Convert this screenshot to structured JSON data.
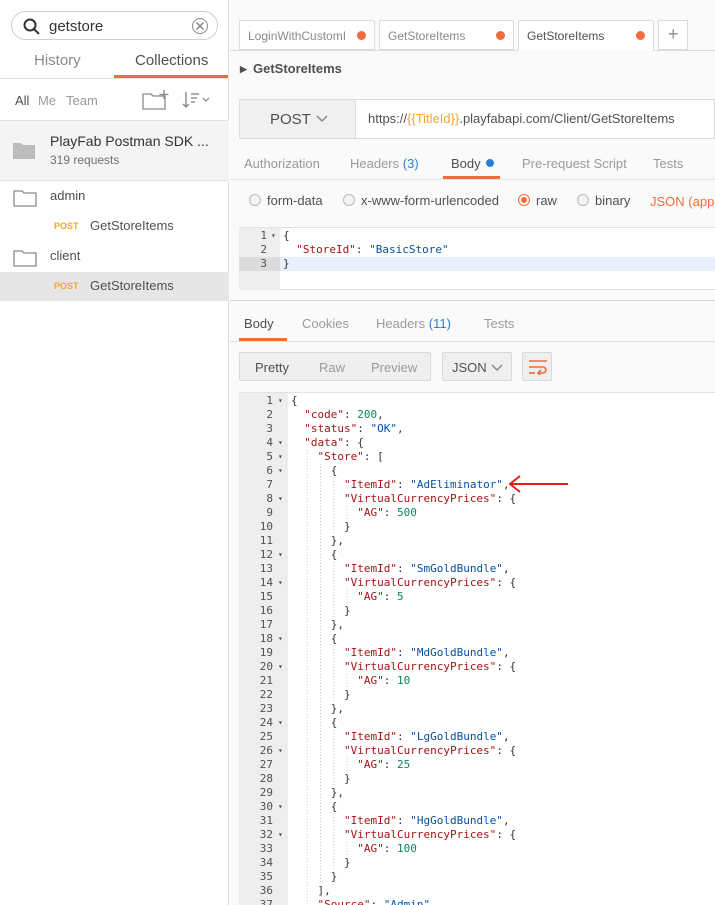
{
  "sidebar": {
    "search": {
      "value": "getstore"
    },
    "tabs": [
      "History",
      "Collections"
    ],
    "filters": [
      "All",
      "Me",
      "Team"
    ],
    "collection": {
      "name": "PlayFab Postman SDK ...",
      "count": "319 requests"
    },
    "folders": [
      {
        "name": "admin",
        "request": {
          "method": "POST",
          "name": "GetStoreItems"
        }
      },
      {
        "name": "client",
        "request": {
          "method": "POST",
          "name": "GetStoreItems"
        }
      }
    ]
  },
  "tabs": [
    {
      "label": "LoginWithCustomI"
    },
    {
      "label": "GetStoreItems"
    },
    {
      "label": "GetStoreItems"
    }
  ],
  "new_tab": "+",
  "request": {
    "title": "GetStoreItems",
    "method": "POST",
    "url_prefix": "https://",
    "url_var": "{{TitleId}}",
    "url_suffix": ".playfabapi.com/Client/GetStoreItems",
    "tabs": {
      "authorization": "Authorization",
      "headers": "Headers",
      "headers_count": "(3)",
      "body": "Body",
      "prerequest": "Pre-request Script",
      "tests": "Tests"
    },
    "body_modes": [
      "form-data",
      "x-www-form-urlencoded",
      "raw",
      "binary"
    ],
    "content_type": "JSON (applic",
    "body_lines": [
      {
        "n": "1",
        "fold": true,
        "text": "{"
      },
      {
        "n": "2",
        "fold": false,
        "text": "  \"StoreId\": \"BasicStore\""
      },
      {
        "n": "3",
        "fold": false,
        "text": "}"
      }
    ]
  },
  "response": {
    "tabs": {
      "body": "Body",
      "cookies": "Cookies",
      "headers": "Headers",
      "headers_count": "(11)",
      "tests": "Tests"
    },
    "view_buttons": [
      "Pretty",
      "Raw",
      "Preview"
    ],
    "format": "JSON",
    "lines": [
      {
        "n": "1",
        "fold": true,
        "text": "{"
      },
      {
        "n": "2",
        "fold": false,
        "text": "  \"code\": 200,"
      },
      {
        "n": "3",
        "fold": false,
        "text": "  \"status\": \"OK\","
      },
      {
        "n": "4",
        "fold": true,
        "text": "  \"data\": {"
      },
      {
        "n": "5",
        "fold": true,
        "text": "    \"Store\": ["
      },
      {
        "n": "6",
        "fold": true,
        "text": "      {"
      },
      {
        "n": "7",
        "fold": false,
        "text": "        \"ItemId\": \"AdEliminator\","
      },
      {
        "n": "8",
        "fold": true,
        "text": "        \"VirtualCurrencyPrices\": {"
      },
      {
        "n": "9",
        "fold": false,
        "text": "          \"AG\": 500"
      },
      {
        "n": "10",
        "fold": false,
        "text": "        }"
      },
      {
        "n": "11",
        "fold": false,
        "text": "      },"
      },
      {
        "n": "12",
        "fold": true,
        "text": "      {"
      },
      {
        "n": "13",
        "fold": false,
        "text": "        \"ItemId\": \"SmGoldBundle\","
      },
      {
        "n": "14",
        "fold": true,
        "text": "        \"VirtualCurrencyPrices\": {"
      },
      {
        "n": "15",
        "fold": false,
        "text": "          \"AG\": 5"
      },
      {
        "n": "16",
        "fold": false,
        "text": "        }"
      },
      {
        "n": "17",
        "fold": false,
        "text": "      },"
      },
      {
        "n": "18",
        "fold": true,
        "text": "      {"
      },
      {
        "n": "19",
        "fold": false,
        "text": "        \"ItemId\": \"MdGoldBundle\","
      },
      {
        "n": "20",
        "fold": true,
        "text": "        \"VirtualCurrencyPrices\": {"
      },
      {
        "n": "21",
        "fold": false,
        "text": "          \"AG\": 10"
      },
      {
        "n": "22",
        "fold": false,
        "text": "        }"
      },
      {
        "n": "23",
        "fold": false,
        "text": "      },"
      },
      {
        "n": "24",
        "fold": true,
        "text": "      {"
      },
      {
        "n": "25",
        "fold": false,
        "text": "        \"ItemId\": \"LgGoldBundle\","
      },
      {
        "n": "26",
        "fold": true,
        "text": "        \"VirtualCurrencyPrices\": {"
      },
      {
        "n": "27",
        "fold": false,
        "text": "          \"AG\": 25"
      },
      {
        "n": "28",
        "fold": false,
        "text": "        }"
      },
      {
        "n": "29",
        "fold": false,
        "text": "      },"
      },
      {
        "n": "30",
        "fold": true,
        "text": "      {"
      },
      {
        "n": "31",
        "fold": false,
        "text": "        \"ItemId\": \"HgGoldBundle\","
      },
      {
        "n": "32",
        "fold": true,
        "text": "        \"VirtualCurrencyPrices\": {"
      },
      {
        "n": "33",
        "fold": false,
        "text": "          \"AG\": 100"
      },
      {
        "n": "34",
        "fold": false,
        "text": "        }"
      },
      {
        "n": "35",
        "fold": false,
        "text": "      }"
      },
      {
        "n": "36",
        "fold": false,
        "text": "    ],"
      },
      {
        "n": "37",
        "fold": false,
        "text": "    \"Source\": \"Admin\""
      }
    ]
  },
  "colors": {
    "accent": "#f26b3a",
    "blue": "#2b7fd1",
    "method_post": "#f4a62a",
    "arrow": "#e02020"
  }
}
